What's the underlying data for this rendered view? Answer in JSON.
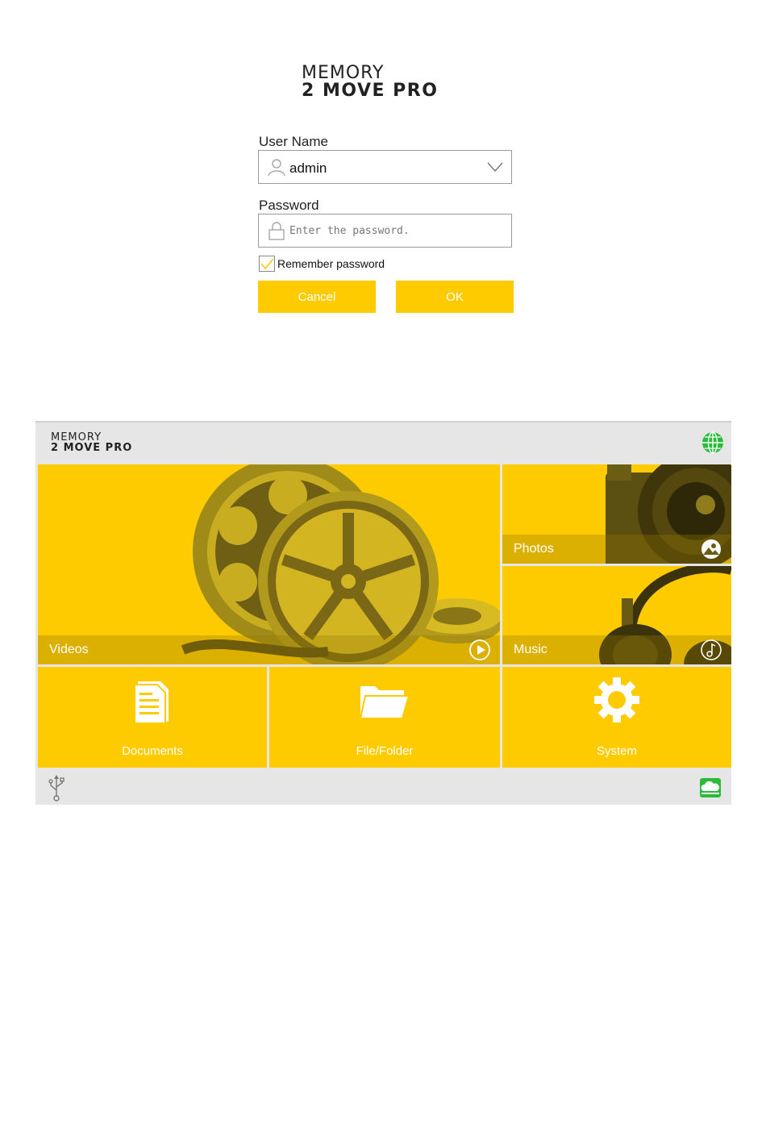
{
  "login": {
    "logo_line1": "MEMORY",
    "logo_line2": "2 MOVE PRO",
    "username_label": "User Name",
    "username_value": "admin",
    "password_label": "Password",
    "password_placeholder": "Enter the password.",
    "remember_label": "Remember password",
    "remember_checked": true,
    "cancel_label": "Cancel",
    "ok_label": "OK"
  },
  "home": {
    "logo_line1": "MEMORY",
    "logo_line2": "2 MOVE PRO",
    "tiles": {
      "videos": "Videos",
      "photos": "Photos",
      "music": "Music",
      "documents": "Documents",
      "filefolder": "File/Folder",
      "system": "System"
    },
    "icons": {
      "header_right": "globe-icon",
      "footer_left": "usb-icon",
      "footer_right": "cloud-drive-icon"
    }
  },
  "colors": {
    "accent": "#fecb00",
    "status_green": "#2bbb3a",
    "bar_gray": "#e6e6e6"
  }
}
